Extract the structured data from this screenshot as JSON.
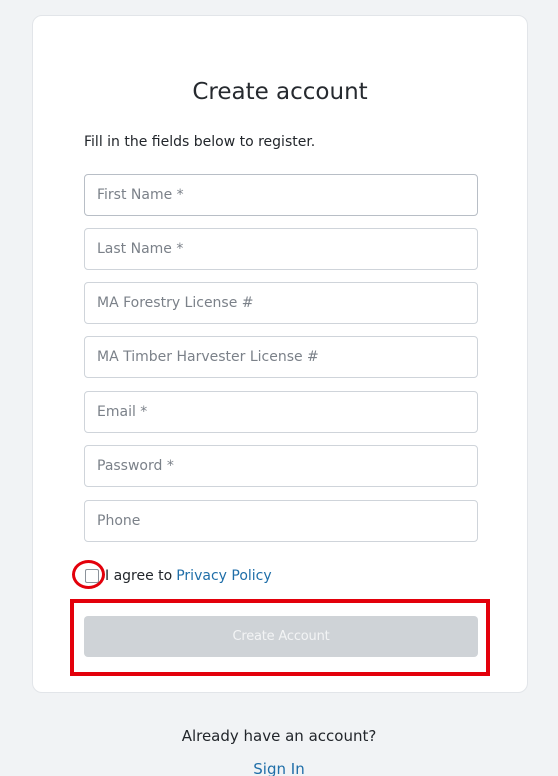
{
  "form": {
    "title": "Create account",
    "subtitle": "Fill in the fields below to register.",
    "fields": [
      {
        "placeholder": "First Name *",
        "value": ""
      },
      {
        "placeholder": "Last Name *",
        "value": ""
      },
      {
        "placeholder": "MA Forestry License #",
        "value": ""
      },
      {
        "placeholder": "MA Timber Harvester License #",
        "value": ""
      },
      {
        "placeholder": "Email *",
        "value": ""
      },
      {
        "placeholder": "Password *",
        "value": ""
      },
      {
        "placeholder": "Phone",
        "value": ""
      }
    ],
    "agree_text": "I agree to",
    "privacy_link": "Privacy Policy",
    "agree_checked": false,
    "submit_label": "Create Account",
    "submit_enabled": false
  },
  "footer": {
    "question": "Already have an account?",
    "signin_label": "Sign In"
  },
  "highlights": {
    "color": "#e3000b"
  },
  "colors": {
    "link": "#1f6ea8",
    "disabled_button": "#cfd3d7"
  }
}
